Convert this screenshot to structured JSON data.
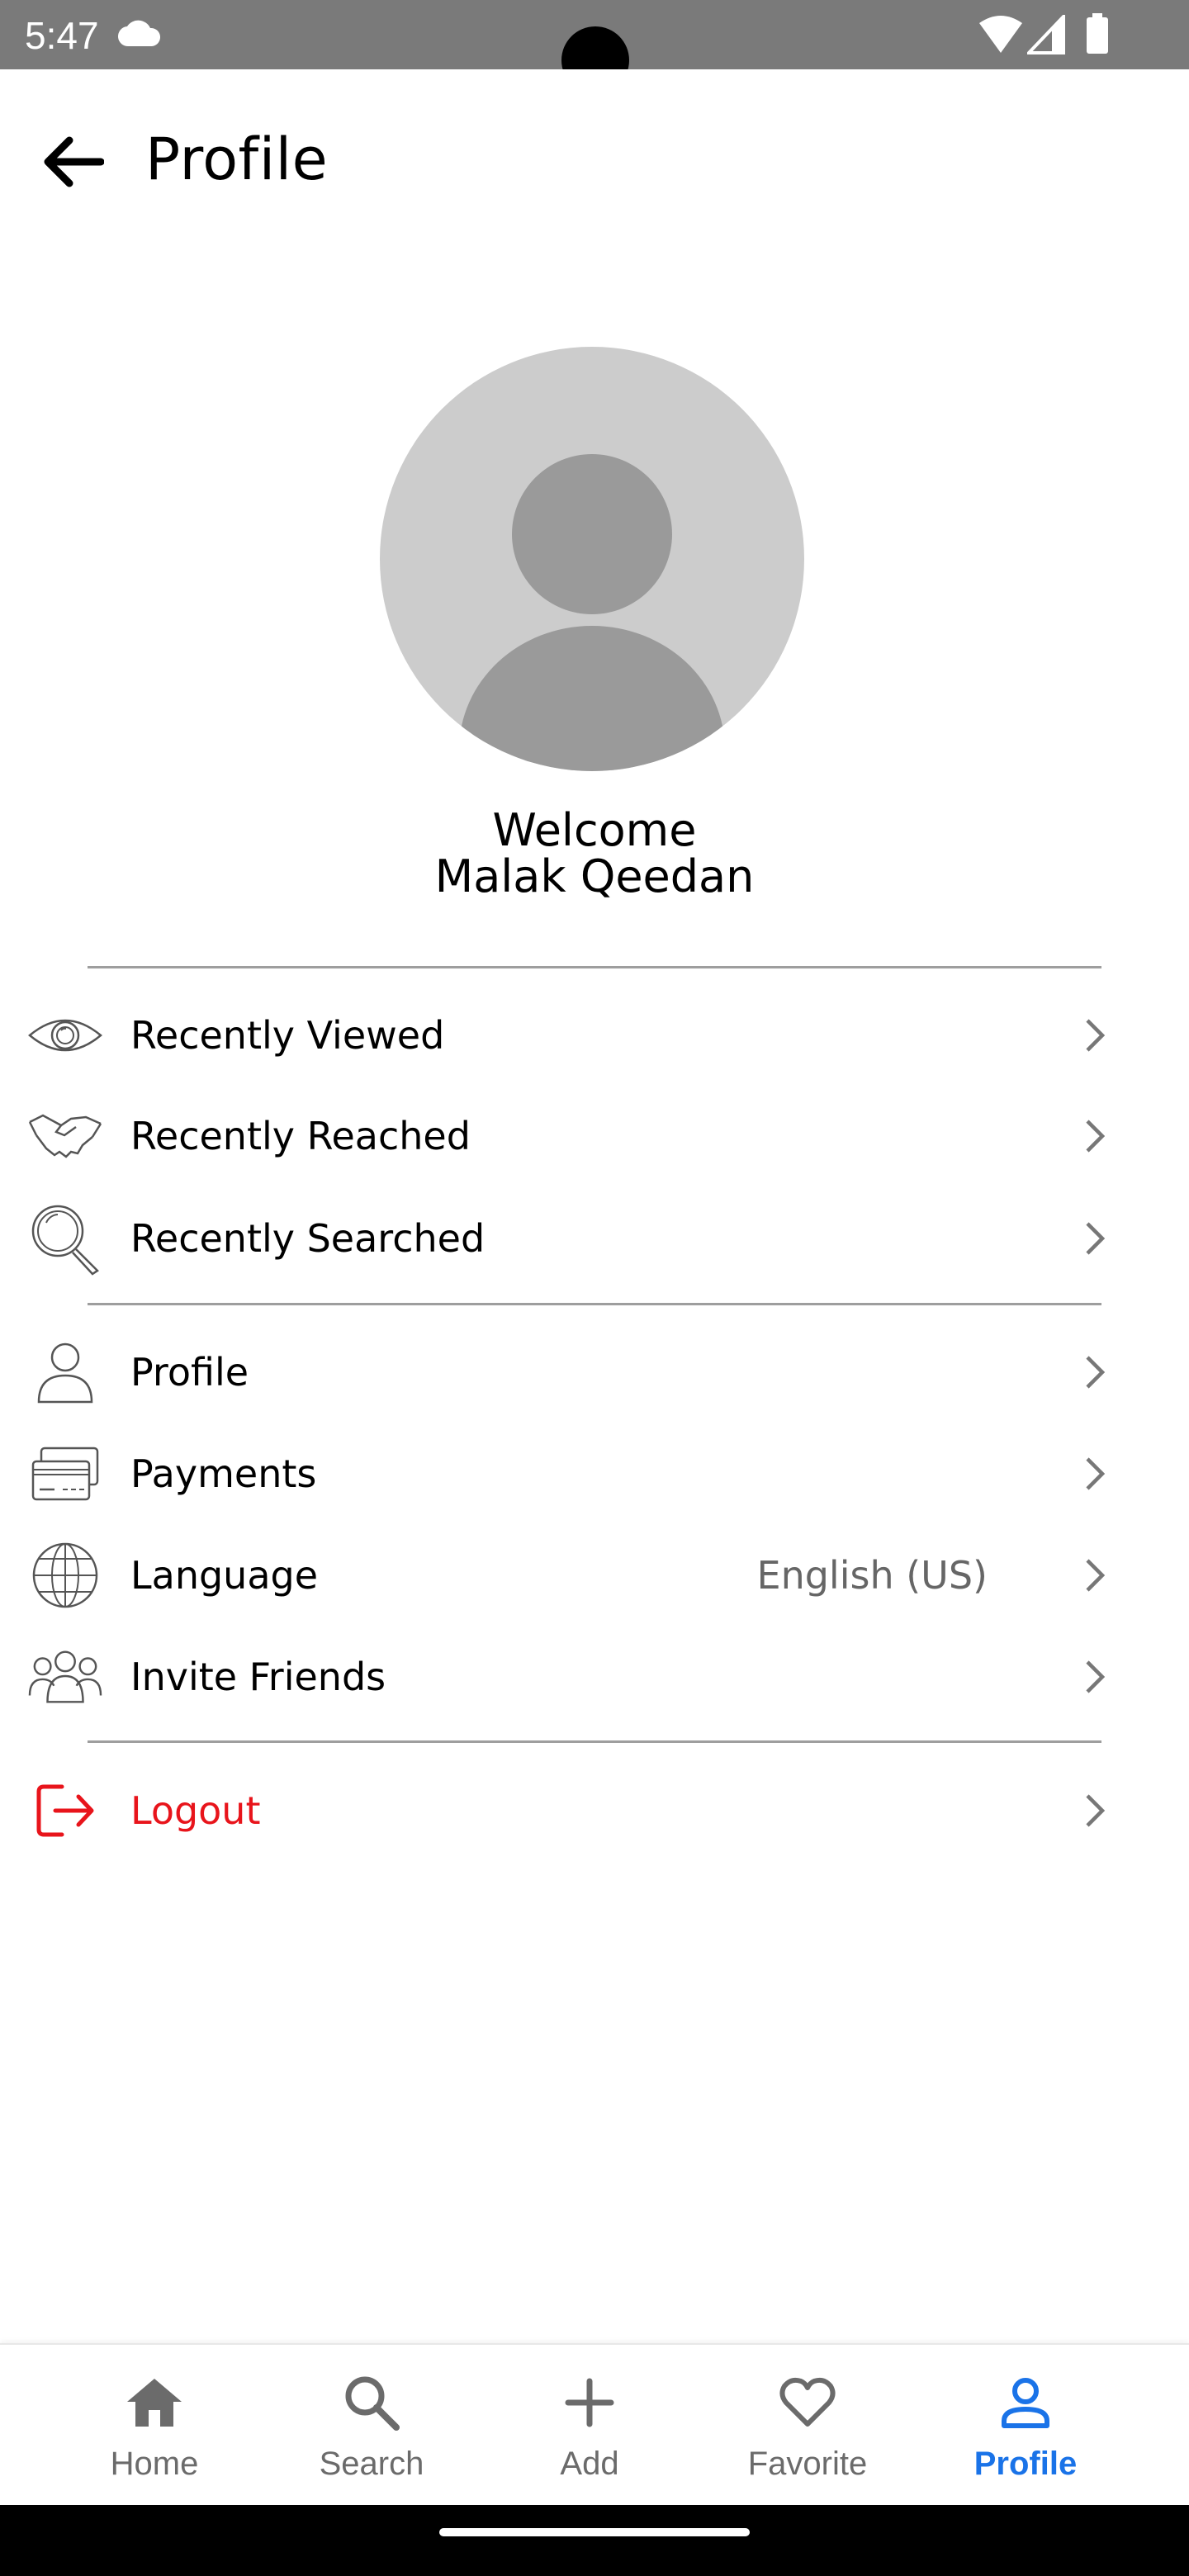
{
  "status_bar": {
    "time": "5:47"
  },
  "header": {
    "title": "Profile"
  },
  "profile": {
    "welcome": "Welcome",
    "name": "Malak Qeedan"
  },
  "menu": {
    "recently_viewed": "Recently Viewed",
    "recently_reached": "Recently Reached",
    "recently_searched": "Recently Searched",
    "profile": "Profile",
    "payments": "Payments",
    "language": "Language",
    "language_value": "English (US)",
    "invite_friends": "Invite Friends",
    "logout": "Logout"
  },
  "bottom_nav": {
    "home": "Home",
    "search": "Search",
    "add": "Add",
    "favorite": "Favorite",
    "profile": "Profile"
  },
  "colors": {
    "accent": "#1a73e8",
    "logout": "#e8141b",
    "status_bar": "#7a7a7a"
  },
  "icons": [
    "cloud-icon",
    "wifi-icon",
    "signal-icon",
    "battery-icon",
    "back-arrow-icon",
    "eye-icon",
    "handshake-icon",
    "magnifier-icon",
    "person-icon",
    "credit-card-icon",
    "globe-icon",
    "group-icon",
    "logout-icon",
    "chevron-right-icon",
    "home-icon",
    "search-icon",
    "plus-icon",
    "heart-icon",
    "profile-icon"
  ]
}
